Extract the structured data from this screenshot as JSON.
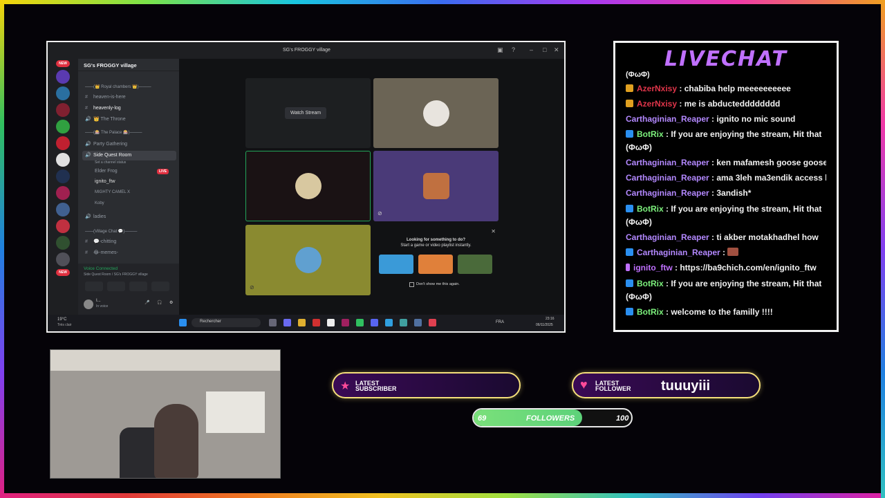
{
  "window": {
    "title": "SG's FROGGY village"
  },
  "servers": {
    "new_badge": "NEW",
    "new_badge2": "NEW"
  },
  "channels": {
    "header": "SG's FROGGY village",
    "items": [
      {
        "name": "——(👑 Royal chambers 👑)———"
      },
      {
        "name": "heaven-is-here"
      },
      {
        "name": "heavenly-log"
      },
      {
        "name": "👑 The Throne"
      },
      {
        "name": "——(🎰 The Palace 🎰)———"
      },
      {
        "name": "Party Gathering"
      },
      {
        "name": "Side Quest Room"
      },
      {
        "name": "Set a channel status"
      },
      {
        "name": "Elder Frog"
      },
      {
        "name": "ignito_ftw"
      },
      {
        "name": "MIGHTY CAMEL X"
      },
      {
        "name": "Koby"
      },
      {
        "name": "ladies"
      },
      {
        "name": "——(Village Chat 💬)———"
      },
      {
        "name": "💬-chitting"
      },
      {
        "name": "😂-memes-"
      }
    ],
    "live_badge": "LIVE",
    "voice_connected": "Voice Connected",
    "voice_sub": "Side Quest Room / SG's FROGGY village",
    "user_status": "In voice",
    "user_name": "I..."
  },
  "main": {
    "watch_stream": "Watch Stream",
    "activity_title": "Looking for something to do?",
    "activity_sub": "Start a game or video playlist instantly.",
    "dont_show": "Don't show me this again."
  },
  "taskbar": {
    "weather_temp": "19°C",
    "weather_desc": "Très clair",
    "search": "Rechercher",
    "lang": "FRA",
    "time": "23:16",
    "date": "06/11/2025"
  },
  "chat": {
    "title": "LIVECHAT",
    "messages": [
      {
        "user": "",
        "text": "(ΦωΦ)"
      },
      {
        "user": "AzerNxisy",
        "text": ": chabiba help meeeeeeeeee"
      },
      {
        "user": "AzerNxisy",
        "text": ": me is abductedddddddd"
      },
      {
        "user": "Carthaginian_Reaper",
        "text": ": ignito no mic sound"
      },
      {
        "user": "BotRix",
        "text": ": If you are enjoying the stream, Hit that"
      },
      {
        "user": "",
        "text": "(ΦωΦ)"
      },
      {
        "user": "Carthaginian_Reaper",
        "text": ": ken mafamesh goose goose"
      },
      {
        "user": "Carthaginian_Reaper",
        "text": ": ama 3leh ma3endik access l"
      },
      {
        "user": "Carthaginian_Reaper",
        "text": ": 3andish*"
      },
      {
        "user": "BotRix",
        "text": ": If you are enjoying the stream, Hit that"
      },
      {
        "user": "",
        "text": "(ΦωΦ)"
      },
      {
        "user": "Carthaginian_Reaper",
        "text": ": ti akber motakhadhel how"
      },
      {
        "user": "Carthaginian_Reaper",
        "text": ":"
      },
      {
        "user": "ignito_ftw",
        "text": ": https://ba9chich.com/en/ignito_ftw"
      },
      {
        "user": "BotRix",
        "text": ": If you are enjoying the stream, Hit that"
      },
      {
        "user": "",
        "text": "(ΦωΦ)"
      },
      {
        "user": "BotRix",
        "text": ": welcome to the familly !!!!"
      }
    ]
  },
  "alerts": {
    "subscriber_label_1": "LATEST",
    "subscriber_label_2": "SUBSCRIBER",
    "subscriber_value": "",
    "follower_label_1": "LATEST",
    "follower_label_2": "FOLLOWER",
    "follower_value": "tuuuyiii"
  },
  "goal": {
    "current": "69",
    "label": "FOLLOWERS",
    "target": "100",
    "progress": 0.69
  },
  "colors": {
    "azer": "#e0354a",
    "reaper": "#b388ff",
    "botrix": "#7cf07c",
    "ignito": "#c070ff"
  }
}
